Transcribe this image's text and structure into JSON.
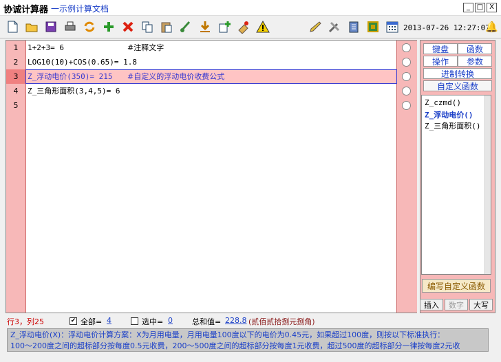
{
  "window": {
    "app_title": "协诚计算器",
    "doc_title": "一示例计算文档",
    "minimize": "_",
    "maximize": "□",
    "close": "X"
  },
  "toolbar": {
    "icons": [
      "new-file-icon",
      "open-folder-icon",
      "save-icon",
      "print-icon",
      "refresh-icon",
      "add-icon",
      "delete-icon",
      "copy-icon",
      "paste-icon",
      "brush-icon",
      "download-icon",
      "insert-icon",
      "stamp-icon",
      "warning-icon",
      "pen-icon",
      "tools-icon",
      "notebook-icon",
      "chip-icon",
      "calendar-icon"
    ],
    "datetime": "2013-07-26  12:27:07"
  },
  "editor": {
    "lines": [
      {
        "num": "1",
        "code": "1+2+3= 6",
        "comment": "#注释文字"
      },
      {
        "num": "2",
        "code": "LOG10(10)+COS(0.65)= 1.8",
        "comment": ""
      },
      {
        "num": "3",
        "code": "Z_浮动电价(350)= 215",
        "comment": "#自定义的浮动电价收费公式"
      },
      {
        "num": "4",
        "code": "Z_三角形面积(3,4,5)= 6",
        "comment": ""
      },
      {
        "num": "5",
        "code": "",
        "comment": ""
      }
    ],
    "selected_line": 3
  },
  "panel": {
    "keyboard": "键盘",
    "function": "函数",
    "operation": "操作",
    "params": "参数",
    "base_convert": "进制转换",
    "custom_function": "自定义函数",
    "functions": [
      "Z_czmd()",
      "Z_浮动电价()",
      "Z_三角形面积()"
    ],
    "write_custom": "编写自定义函数",
    "tab_insert": "插入",
    "tab_digits": "数字",
    "tab_upper": "大写"
  },
  "status": {
    "row_col": "行3，列25",
    "all_check": "✔",
    "all_label": "全部=",
    "all_value": "4",
    "sel_label": "选中=",
    "sel_value": "0",
    "sum_label": "总和值=",
    "sum_value": "228.8",
    "sum_chinese": "(贰佰贰拾捌元捌角)"
  },
  "info": {
    "line1": "Z_浮动电价(X)：浮动电价计算方案：X为月用电量，月用电量100度以下的电价为0.45元，如果超过100度，则按以下标准执行：",
    "line2": "100～200度之间的超标部分按每度0.5元收费，200～500度之间的超标部分按每度1元收费，超过500度的超标部分一律按每度2元收"
  }
}
